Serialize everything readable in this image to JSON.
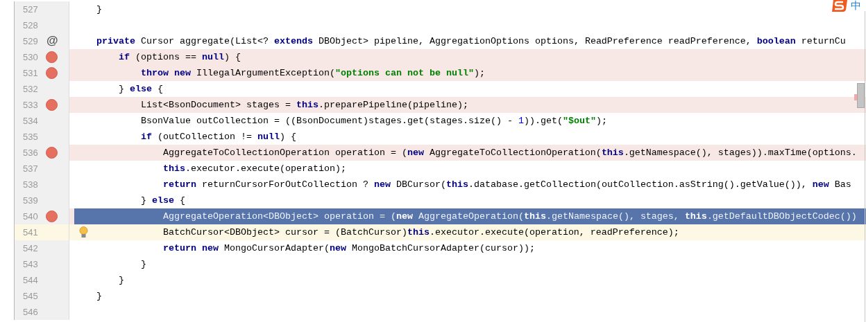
{
  "ime_indicator": {
    "label": "中"
  },
  "lines": [
    {
      "number": "527",
      "breakpoint": false,
      "bulb": false,
      "selected": false,
      "caret_line": false,
      "tokens": [
        {
          "kind": "plain",
          "text": "    }"
        }
      ]
    },
    {
      "number": "528",
      "breakpoint": false,
      "bulb": false,
      "selected": false,
      "caret_line": false
    },
    {
      "number": "529",
      "breakpoint": false,
      "bulb": false,
      "selected": false,
      "caret_line": false,
      "gutter_text": "@",
      "tokens": [
        {
          "kind": "keyword",
          "text": "    private"
        },
        {
          "kind": "plain",
          "text": " Cursor aggregate(List<? "
        },
        {
          "kind": "keyword",
          "text": "extends"
        },
        {
          "kind": "plain",
          "text": " DBObject> pipeline, AggregationOptions options, ReadPreference readPreference, "
        },
        {
          "kind": "keyword",
          "text": "boolean"
        },
        {
          "kind": "plain",
          "text": " returnCu"
        }
      ]
    },
    {
      "number": "530",
      "breakpoint": true,
      "bulb": false,
      "selected": false,
      "caret_line": false,
      "tokens": [
        {
          "kind": "keyword",
          "text": "        if"
        },
        {
          "kind": "plain",
          "text": " (options == "
        },
        {
          "kind": "keyword",
          "text": "null"
        },
        {
          "kind": "plain",
          "text": ") {"
        }
      ]
    },
    {
      "number": "531",
      "breakpoint": true,
      "bulb": false,
      "selected": false,
      "caret_line": false,
      "tokens": [
        {
          "kind": "keyword",
          "text": "            throw new"
        },
        {
          "kind": "plain",
          "text": " IllegalArgumentException("
        },
        {
          "kind": "string",
          "text": "\"options can not be null\""
        },
        {
          "kind": "plain",
          "text": ");"
        }
      ]
    },
    {
      "number": "532",
      "breakpoint": false,
      "bulb": false,
      "selected": false,
      "caret_line": false,
      "tokens": [
        {
          "kind": "plain",
          "text": "        } "
        },
        {
          "kind": "keyword",
          "text": "else"
        },
        {
          "kind": "plain",
          "text": " {"
        }
      ]
    },
    {
      "number": "533",
      "breakpoint": true,
      "bulb": false,
      "selected": false,
      "caret_line": false,
      "tokens": [
        {
          "kind": "plain",
          "text": "            List<BsonDocument> stages = "
        },
        {
          "kind": "keyword",
          "text": "this"
        },
        {
          "kind": "plain",
          "text": ".preparePipeline(pipeline);"
        }
      ]
    },
    {
      "number": "534",
      "breakpoint": false,
      "bulb": false,
      "selected": false,
      "caret_line": false,
      "tokens": [
        {
          "kind": "plain",
          "text": "            BsonValue outCollection = ((BsonDocument)stages.get(stages.size() - "
        },
        {
          "kind": "number",
          "text": "1"
        },
        {
          "kind": "plain",
          "text": ")).get("
        },
        {
          "kind": "string",
          "text": "\"$out\""
        },
        {
          "kind": "plain",
          "text": ");"
        }
      ]
    },
    {
      "number": "535",
      "breakpoint": false,
      "bulb": false,
      "selected": false,
      "caret_line": false,
      "tokens": [
        {
          "kind": "keyword",
          "text": "            if"
        },
        {
          "kind": "plain",
          "text": " (outCollection != "
        },
        {
          "kind": "keyword",
          "text": "null"
        },
        {
          "kind": "plain",
          "text": ") {"
        }
      ]
    },
    {
      "number": "536",
      "breakpoint": true,
      "bulb": false,
      "selected": false,
      "caret_line": false,
      "tokens": [
        {
          "kind": "plain",
          "text": "                AggregateToCollectionOperation operation = ("
        },
        {
          "kind": "keyword",
          "text": "new"
        },
        {
          "kind": "plain",
          "text": " AggregateToCollectionOperation("
        },
        {
          "kind": "keyword",
          "text": "this"
        },
        {
          "kind": "plain",
          "text": ".getNamespace(), stages)).maxTime(options."
        }
      ]
    },
    {
      "number": "537",
      "breakpoint": false,
      "bulb": false,
      "selected": false,
      "caret_line": false,
      "tokens": [
        {
          "kind": "keyword",
          "text": "                this"
        },
        {
          "kind": "plain",
          "text": ".executor.execute(operation);"
        }
      ]
    },
    {
      "number": "538",
      "breakpoint": false,
      "bulb": false,
      "selected": false,
      "caret_line": false,
      "tokens": [
        {
          "kind": "keyword",
          "text": "                return"
        },
        {
          "kind": "plain",
          "text": " returnCursorForOutCollection ? "
        },
        {
          "kind": "keyword",
          "text": "new"
        },
        {
          "kind": "plain",
          "text": " DBCursor("
        },
        {
          "kind": "keyword",
          "text": "this"
        },
        {
          "kind": "plain",
          "text": ".database.getCollection(outCollection.asString().getValue()), "
        },
        {
          "kind": "keyword",
          "text": "new"
        },
        {
          "kind": "plain",
          "text": " Bas"
        }
      ]
    },
    {
      "number": "539",
      "breakpoint": false,
      "bulb": false,
      "selected": false,
      "caret_line": false,
      "tokens": [
        {
          "kind": "plain",
          "text": "            } "
        },
        {
          "kind": "keyword",
          "text": "else"
        },
        {
          "kind": "plain",
          "text": " {"
        }
      ]
    },
    {
      "number": "540",
      "breakpoint": true,
      "bulb": false,
      "selected": true,
      "caret_line": false,
      "tokens": [
        {
          "kind": "plain",
          "text": "                AggregateOperation<DBObject> operation = ("
        },
        {
          "kind": "keyword",
          "text": "new"
        },
        {
          "kind": "plain",
          "text": " AggregateOperation("
        },
        {
          "kind": "keyword",
          "text": "this"
        },
        {
          "kind": "plain",
          "text": ".getNamespace(), stages, "
        },
        {
          "kind": "keyword",
          "text": "this"
        },
        {
          "kind": "plain",
          "text": ".getDefaultDBObjectCodec())"
        }
      ]
    },
    {
      "number": "541",
      "breakpoint": false,
      "bulb": true,
      "selected": false,
      "caret_line": true,
      "tokens": [
        {
          "kind": "plain",
          "text": "                BatchCursor<DBObject> cursor = (BatchCursor)"
        },
        {
          "kind": "keyword",
          "text": "this"
        },
        {
          "kind": "plain",
          "text": ".executor.execute(operation, readPreference);"
        }
      ]
    },
    {
      "number": "542",
      "breakpoint": false,
      "bulb": false,
      "selected": false,
      "caret_line": false,
      "tokens": [
        {
          "kind": "keyword",
          "text": "                return new"
        },
        {
          "kind": "plain",
          "text": " MongoCursorAdapter("
        },
        {
          "kind": "keyword",
          "text": "new"
        },
        {
          "kind": "plain",
          "text": " MongoBatchCursorAdapter(cursor));"
        }
      ]
    },
    {
      "number": "543",
      "breakpoint": false,
      "bulb": false,
      "selected": false,
      "caret_line": false,
      "tokens": [
        {
          "kind": "plain",
          "text": "            }"
        }
      ]
    },
    {
      "number": "544",
      "breakpoint": false,
      "bulb": false,
      "selected": false,
      "caret_line": false,
      "tokens": [
        {
          "kind": "plain",
          "text": "        }"
        }
      ]
    },
    {
      "number": "545",
      "breakpoint": false,
      "bulb": false,
      "selected": false,
      "caret_line": false,
      "tokens": [
        {
          "kind": "plain",
          "text": "    }"
        }
      ]
    },
    {
      "number": "546",
      "breakpoint": false,
      "bulb": false,
      "selected": false,
      "caret_line": false
    }
  ]
}
